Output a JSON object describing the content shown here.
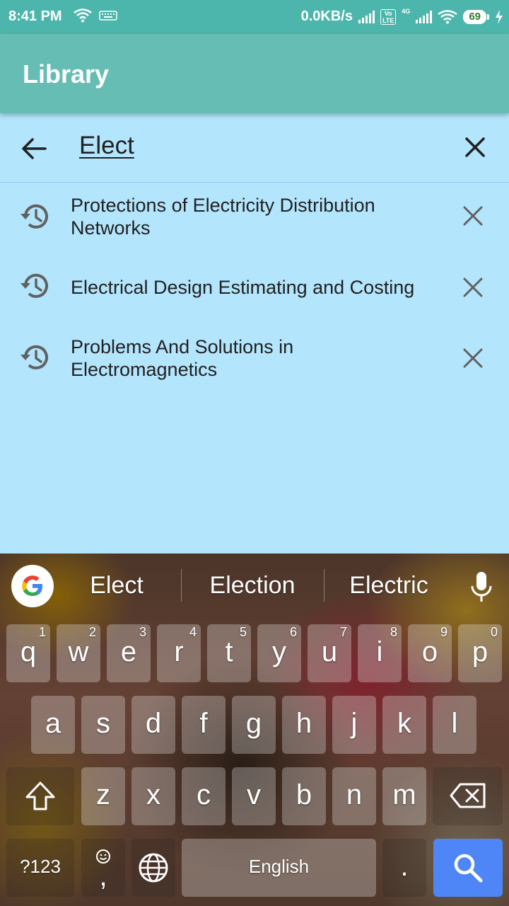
{
  "status_bar": {
    "time": "8:41 PM",
    "net_speed": "0.0KB/s",
    "volte": "Vo\nLTE",
    "network_type": "4G",
    "battery_level": "69"
  },
  "app_bar": {
    "title": "Library"
  },
  "search": {
    "query": "Elect"
  },
  "suggestions": [
    {
      "text": "Protections of Electricity Distribution Networks"
    },
    {
      "text": "Electrical Design Estimating and Costing"
    },
    {
      "text": "Problems And Solutions in Electromagnetics"
    }
  ],
  "keyboard": {
    "word_suggestions": [
      "Elect",
      "Election",
      "Electric"
    ],
    "row1": [
      {
        "l": "q",
        "n": "1"
      },
      {
        "l": "w",
        "n": "2"
      },
      {
        "l": "e",
        "n": "3"
      },
      {
        "l": "r",
        "n": "4"
      },
      {
        "l": "t",
        "n": "5"
      },
      {
        "l": "y",
        "n": "6"
      },
      {
        "l": "u",
        "n": "7"
      },
      {
        "l": "i",
        "n": "8"
      },
      {
        "l": "o",
        "n": "9"
      },
      {
        "l": "p",
        "n": "0"
      }
    ],
    "row2": [
      "a",
      "s",
      "d",
      "f",
      "g",
      "h",
      "j",
      "k",
      "l"
    ],
    "row3": [
      "z",
      "x",
      "c",
      "v",
      "b",
      "n",
      "m"
    ],
    "symbols_label": "?123",
    "comma_label": ",",
    "space_label": "English",
    "period_label": "."
  },
  "colors": {
    "status_bar": "#4db6ac",
    "app_bar": "#66bdb3",
    "background": "#b3e5fc",
    "search_key": "#4f86f7"
  }
}
